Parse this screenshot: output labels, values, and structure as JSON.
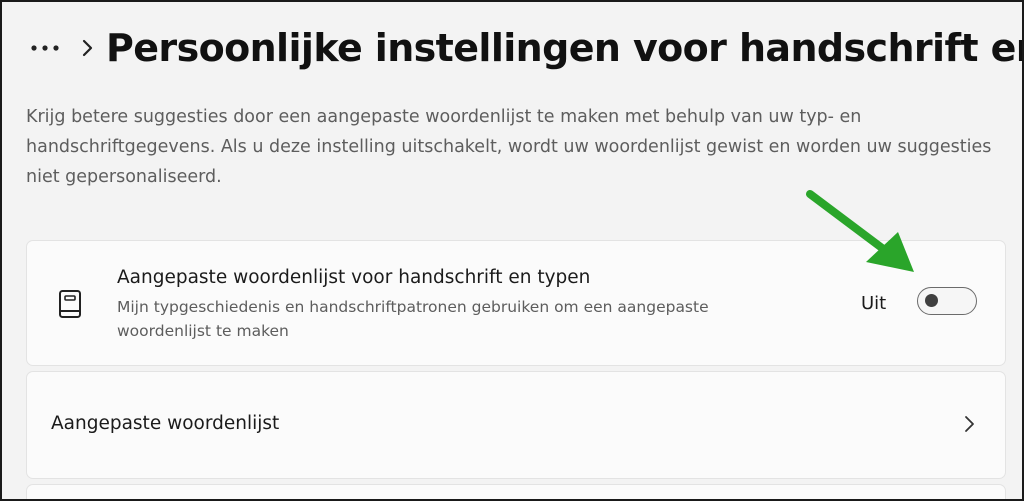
{
  "header": {
    "more_icon": "more-horizontal-icon",
    "breadcrumb_icon": "chevron-right-icon",
    "title": "Persoonlijke instellingen voor handschrift er"
  },
  "description": "Krijg betere suggesties door een aangepaste woordenlijst te maken met behulp van uw typ- en handschriftgegevens. Als u deze instelling uitschakelt, wordt uw woordenlijst gewist en worden uw suggesties niet gepersonaliseerd.",
  "settings": {
    "custom_dictionary_toggle": {
      "icon": "book-icon",
      "title": "Aangepaste woordenlijst voor handschrift en typen",
      "subtitle": "Mijn typgeschiedenis en handschriftpatronen gebruiken om een aangepaste woordenlijst te maken",
      "state_label": "Uit",
      "checked": false
    },
    "custom_dictionary_link": {
      "label": "Aangepaste woordenlijst",
      "icon": "chevron-right-icon"
    }
  },
  "annotation": {
    "arrow_color": "#2aa52a"
  }
}
